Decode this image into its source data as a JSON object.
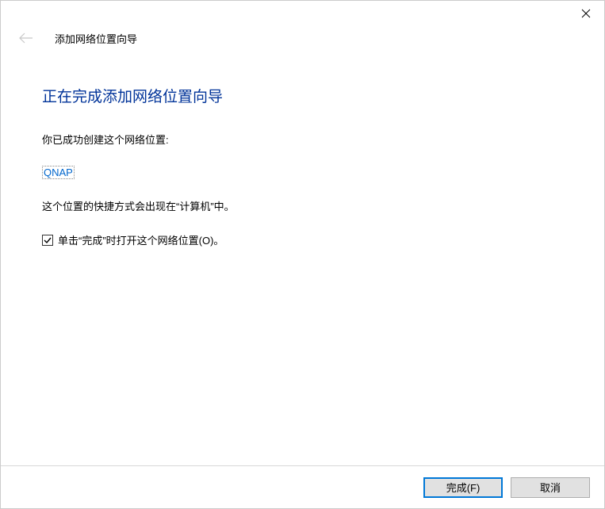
{
  "titlebar": {
    "close_label": "Close"
  },
  "header": {
    "wizard_name": "添加网络位置向导"
  },
  "content": {
    "title": "正在完成添加网络位置向导",
    "success_text": "你已成功创建这个网络位置:",
    "location_link": "QNAP",
    "shortcut_text": "这个位置的快捷方式会出现在“计算机”中。",
    "checkbox_label": "单击“完成”时打开这个网络位置(O)。"
  },
  "footer": {
    "finish_label": "完成(F)",
    "cancel_label": "取消"
  }
}
